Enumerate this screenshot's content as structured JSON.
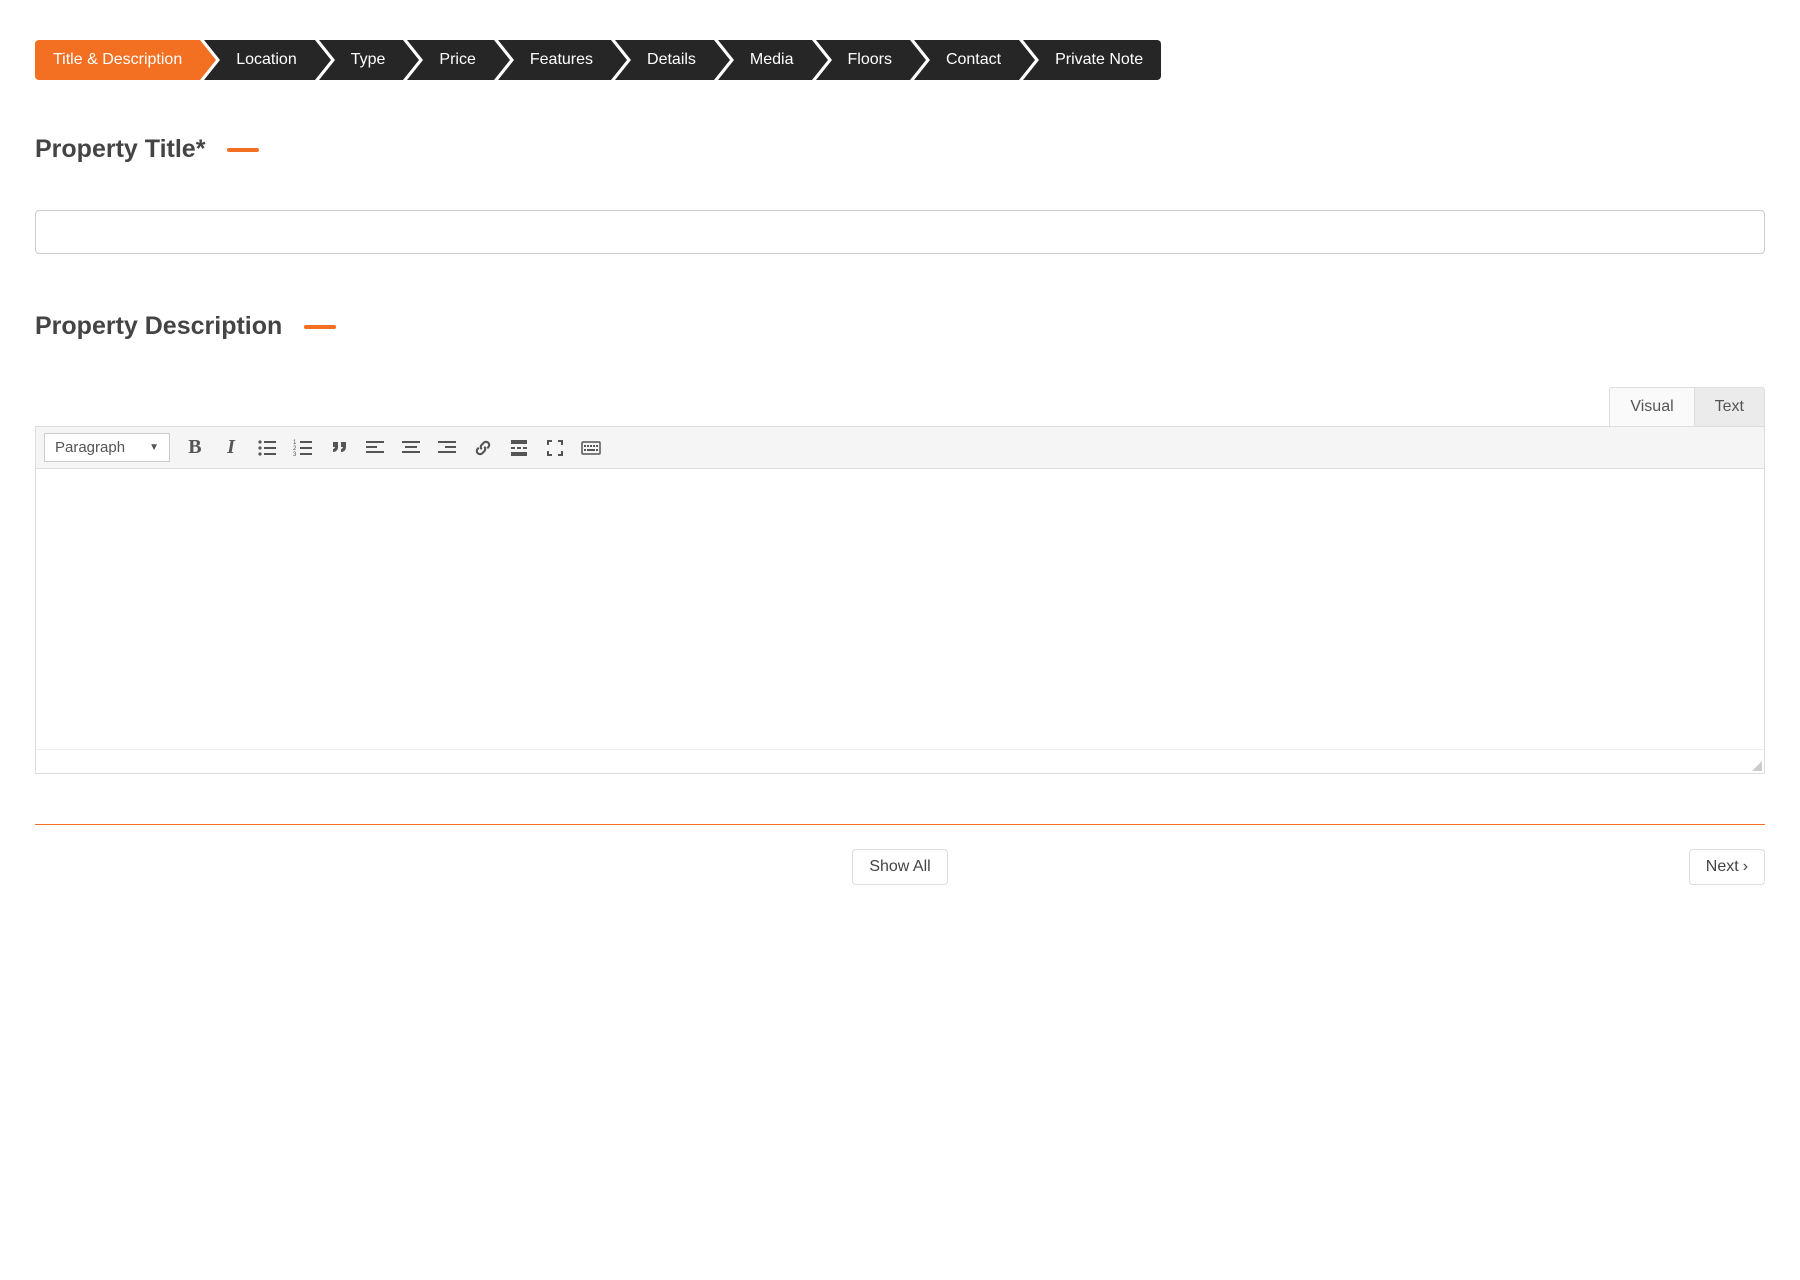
{
  "steps": [
    {
      "label": "Title & Description",
      "active": true
    },
    {
      "label": "Location",
      "active": false
    },
    {
      "label": "Type",
      "active": false
    },
    {
      "label": "Price",
      "active": false
    },
    {
      "label": "Features",
      "active": false
    },
    {
      "label": "Details",
      "active": false
    },
    {
      "label": "Media",
      "active": false
    },
    {
      "label": "Floors",
      "active": false
    },
    {
      "label": "Contact",
      "active": false
    },
    {
      "label": "Private Note",
      "active": false
    }
  ],
  "headings": {
    "title": "Property Title*",
    "description": "Property Description"
  },
  "title_value": "",
  "editor": {
    "tabs": {
      "visual": "Visual",
      "text": "Text"
    },
    "format_selector": "Paragraph"
  },
  "footer": {
    "show_all": "Show All",
    "next": "Next"
  },
  "colors": {
    "accent": "#f36f21"
  }
}
